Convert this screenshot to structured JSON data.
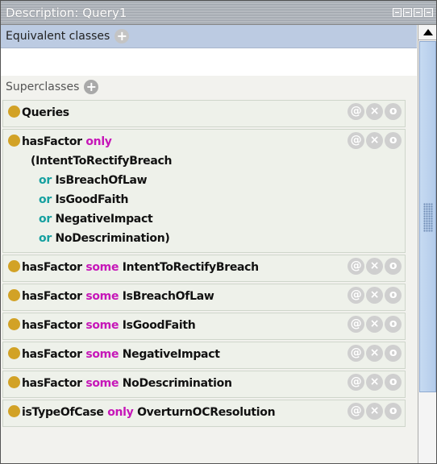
{
  "window": {
    "title": "Description: Query1"
  },
  "sections": {
    "equivalent": {
      "label": "Equivalent classes"
    },
    "superclasses": {
      "label": "Superclasses"
    }
  },
  "actions": {
    "annotate": "@",
    "delete": "×",
    "edit": "o"
  },
  "rows": [
    {
      "parts": [
        {
          "text": "Queries",
          "kind": "plain"
        }
      ]
    },
    {
      "multiline": true,
      "lines": [
        {
          "parts": [
            {
              "text": "hasFactor ",
              "kind": "plain"
            },
            {
              "text": "only",
              "kind": "purple"
            }
          ]
        },
        {
          "parts": [
            {
              "text": "(IntentToRectifyBreach",
              "kind": "plain"
            }
          ]
        },
        {
          "parts": [
            {
              "text": "or ",
              "kind": "teal"
            },
            {
              "text": "IsBreachOfLaw",
              "kind": "plain"
            }
          ]
        },
        {
          "parts": [
            {
              "text": "or ",
              "kind": "teal"
            },
            {
              "text": "IsGoodFaith",
              "kind": "plain"
            }
          ]
        },
        {
          "parts": [
            {
              "text": "or ",
              "kind": "teal"
            },
            {
              "text": "NegativeImpact",
              "kind": "plain"
            }
          ]
        },
        {
          "parts": [
            {
              "text": "or ",
              "kind": "teal"
            },
            {
              "text": "NoDescrimination)",
              "kind": "plain"
            }
          ]
        }
      ]
    },
    {
      "parts": [
        {
          "text": "hasFactor ",
          "kind": "plain"
        },
        {
          "text": "some ",
          "kind": "purple"
        },
        {
          "text": "IntentToRectifyBreach",
          "kind": "plain"
        }
      ]
    },
    {
      "parts": [
        {
          "text": "hasFactor ",
          "kind": "plain"
        },
        {
          "text": "some ",
          "kind": "purple"
        },
        {
          "text": "IsBreachOfLaw",
          "kind": "plain"
        }
      ]
    },
    {
      "parts": [
        {
          "text": "hasFactor ",
          "kind": "plain"
        },
        {
          "text": "some ",
          "kind": "purple"
        },
        {
          "text": "IsGoodFaith",
          "kind": "plain"
        }
      ]
    },
    {
      "parts": [
        {
          "text": "hasFactor ",
          "kind": "plain"
        },
        {
          "text": "some ",
          "kind": "purple"
        },
        {
          "text": "NegativeImpact",
          "kind": "plain"
        }
      ]
    },
    {
      "parts": [
        {
          "text": "hasFactor ",
          "kind": "plain"
        },
        {
          "text": "some ",
          "kind": "purple"
        },
        {
          "text": "NoDescrimination",
          "kind": "plain"
        }
      ]
    },
    {
      "parts": [
        {
          "text": "isTypeOfCase ",
          "kind": "plain"
        },
        {
          "text": "only ",
          "kind": "purple"
        },
        {
          "text": "OverturnOCResolution",
          "kind": "plain"
        }
      ]
    }
  ],
  "colors": {
    "class_dot": "#d2a226",
    "keyword_quantifier": "#c616b8",
    "keyword_or": "#16a0a0",
    "header_bg": "#bccbe2"
  }
}
